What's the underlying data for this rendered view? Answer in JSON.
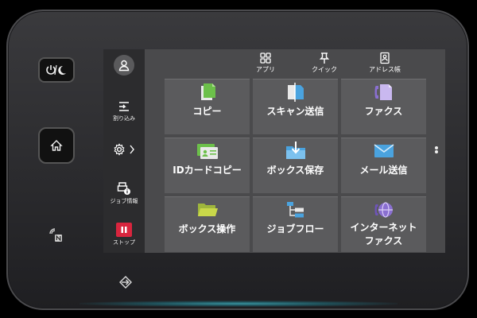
{
  "sidebar": {
    "interrupt_label": "割り込み",
    "job_info_label": "ジョブ情報",
    "stop_label": "ストップ"
  },
  "top_shortcuts": [
    {
      "label": "アプリ",
      "icon": "apps-grid-icon"
    },
    {
      "label": "クイック",
      "icon": "pin-icon"
    },
    {
      "label": "アドレス帳",
      "icon": "address-book-icon"
    }
  ],
  "tiles": [
    {
      "label": "コピー",
      "icon": "copy-icon"
    },
    {
      "label": "スキャン送信",
      "icon": "scan-send-icon"
    },
    {
      "label": "ファクス",
      "icon": "fax-icon"
    },
    {
      "label": "IDカードコピー",
      "icon": "id-card-icon"
    },
    {
      "label": "ボックス保存",
      "icon": "box-save-icon"
    },
    {
      "label": "メール送信",
      "icon": "mail-icon"
    },
    {
      "label": "ボックス操作",
      "icon": "box-folder-icon"
    },
    {
      "label": "ジョブフロー",
      "icon": "job-flow-icon"
    },
    {
      "label": "インターネット",
      "label2": "ファクス",
      "icon": "internet-fax-icon"
    }
  ],
  "colors": {
    "accent_blue": "#4aa3df",
    "accent_green": "#6cc04a",
    "accent_purple": "#8a6fd1",
    "accent_yellow": "#c9d84a",
    "stop_red": "#d9253e"
  }
}
